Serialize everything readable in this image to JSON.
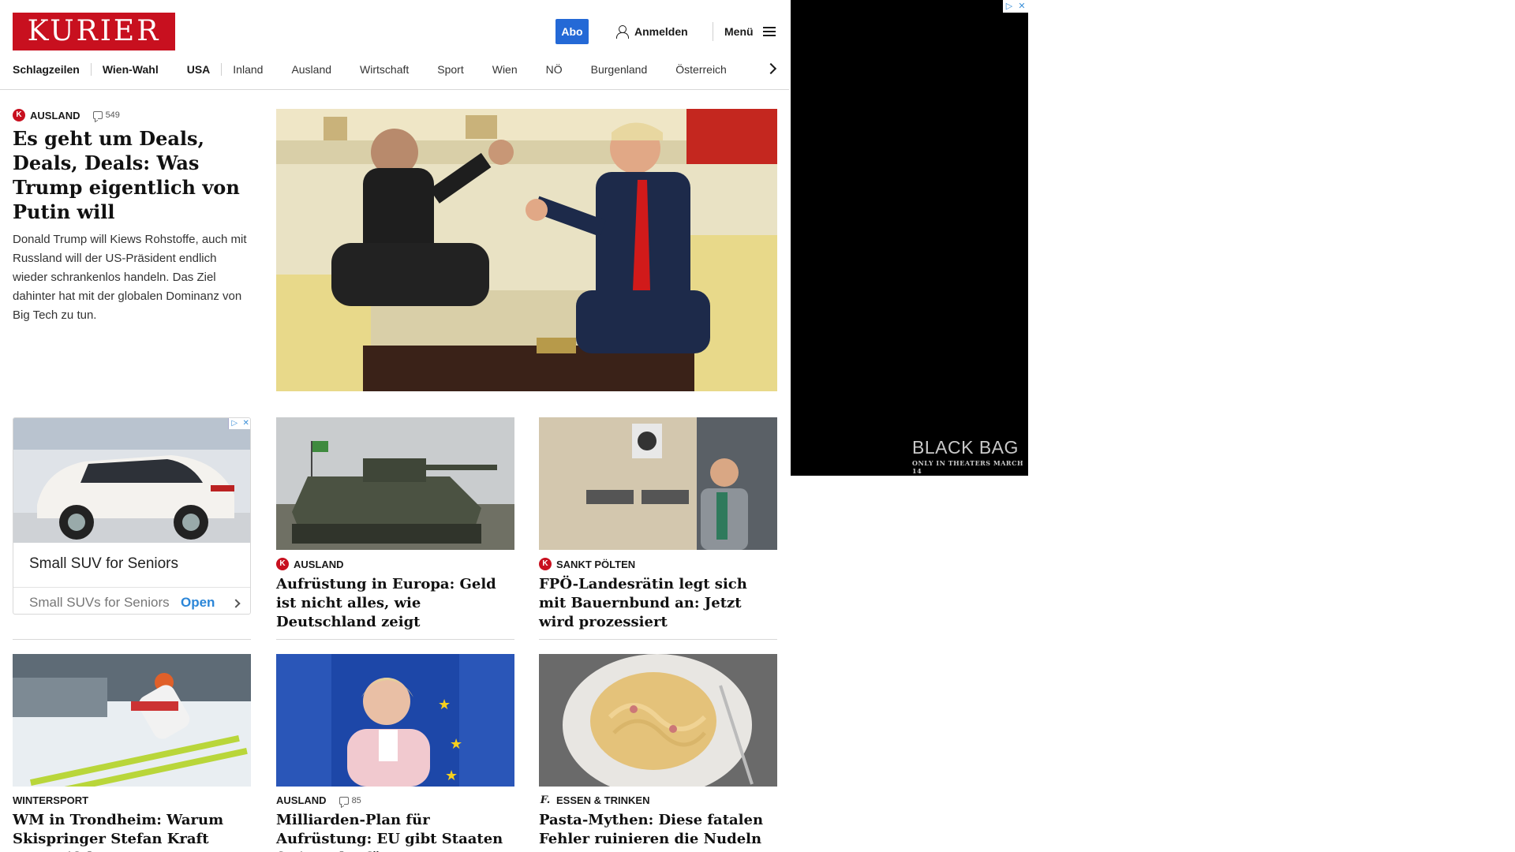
{
  "header": {
    "logo": "KURIER",
    "abo_label": "Abo",
    "login_label": "Anmelden",
    "menu_label": "Menü",
    "brand_color": "#c8101f",
    "accent_color": "#2469d6"
  },
  "nav": {
    "items": [
      "Schlagzeilen",
      "Wien-Wahl",
      "USA",
      "Inland",
      "Ausland",
      "Wirtschaft",
      "Sport",
      "Wien",
      "NÖ",
      "Burgenland",
      "Österreich"
    ]
  },
  "lead": {
    "kicker": "AUSLAND",
    "comments": "549",
    "title": "Es geht um Deals, Deals, Deals: Was Trump eigentlich von Putin will",
    "teaser": "Donald Trump will Kiews Rohstoffe, auch mit Russland will der US-Präsident endlich wieder schrankenlos handeln. Das Ziel dahinter hat mit der globalen Dominanz von Big Tech zu tun."
  },
  "ad_card": {
    "title": "Small SUV for Seniors",
    "subtitle": "Small SUVs for Seniors",
    "cta": "Open"
  },
  "cards": [
    {
      "kicker": "AUSLAND",
      "title": "Aufrüstung in Europa: Geld ist nicht alles, wie Deutschland zeigt"
    },
    {
      "kicker": "SANKT PÖLTEN",
      "title": "FPÖ-Landesrätin legt sich mit Bauernbund an: Jetzt wird prozessiert"
    },
    {
      "kicker": "WINTERSPORT",
      "title": "WM in Trondheim: Warum Skispringer Stefan Kraft verzweifelt"
    },
    {
      "kicker": "AUSLAND",
      "comments": "85",
      "title": "Milliarden-Plan für Aufrüstung: EU gibt Staaten freie Bahn für Militärausgaben"
    },
    {
      "kicker": "ESSEN & TRINKEN",
      "title": "Pasta-Mythen: Diese fatalen Fehler ruinieren die Nudeln"
    }
  ],
  "side_ad": {
    "title": "BLACK BAG",
    "subtitle": "ONLY IN THEATERS MARCH 14"
  }
}
